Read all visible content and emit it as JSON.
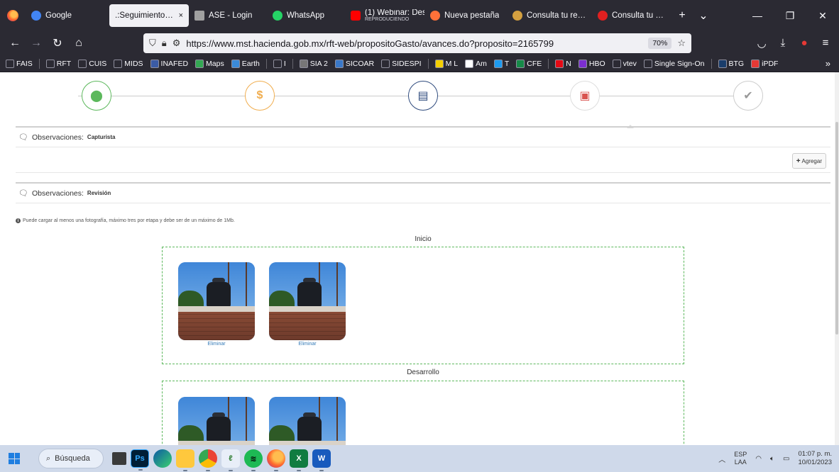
{
  "browser": {
    "tabs": [
      {
        "label": "Google",
        "color": "#4285f4",
        "active": false
      },
      {
        "label": ".:Seguimiento de l",
        "color": "#2e4a7d",
        "active": true
      },
      {
        "label": "ASE - Login",
        "color": "#a0a0a0",
        "active": false
      },
      {
        "label": "WhatsApp",
        "color": "#25d366",
        "active": false
      },
      {
        "label": "(1) Webinar: Des",
        "sub": "REPRODUCIENDO",
        "color": "#ff0000",
        "active": false
      },
      {
        "label": "Nueva pestaña",
        "color": "#ff7139",
        "active": false
      },
      {
        "label": "Consulta tu recib",
        "color": "#d4a040",
        "active": false
      },
      {
        "label": "Consulta tu recib",
        "color": "#e02020",
        "active": false
      }
    ],
    "tab_close": "×",
    "new_tab": "+",
    "tab_list": "⌄",
    "window_controls": {
      "minimize": "—",
      "maximize": "❐",
      "close": "✕"
    },
    "url": "https://www.mst.hacienda.gob.mx/rft-web/propositoGasto/avances.do?proposito=2165799",
    "zoom": "70%",
    "bookmarks": [
      {
        "label": "FAIS",
        "color": "#2b2a33"
      },
      {
        "label": "RFT",
        "color": "#2b2a33"
      },
      {
        "label": "CUIS",
        "color": "#2b2a33"
      },
      {
        "label": "MIDS",
        "color": "#2b2a33"
      },
      {
        "label": "INAFED",
        "color": "#3b5ba5"
      },
      {
        "label": "Maps",
        "color": "#34a853"
      },
      {
        "label": "Earth",
        "color": "#3b8ad8"
      },
      {
        "label": "I",
        "color": "#2b2a33"
      },
      {
        "label": "SIA 2",
        "color": "#777777"
      },
      {
        "label": "SICOAR",
        "color": "#3a78c8"
      },
      {
        "label": "SIDESPI",
        "color": "#2b2a33"
      },
      {
        "label": "M L",
        "color": "#f5d000"
      },
      {
        "label": "Am",
        "color": "#ffffff"
      },
      {
        "label": "T",
        "color": "#1d9bf0"
      },
      {
        "label": "CFE",
        "color": "#168a48"
      },
      {
        "label": "N",
        "color": "#e50914"
      },
      {
        "label": "HBO",
        "color": "#7b2fd0"
      },
      {
        "label": "vtev",
        "color": "#2b2a33"
      },
      {
        "label": "Single Sign-On",
        "color": "#2b2a33"
      },
      {
        "label": "BTG",
        "color": "#1a3d6b"
      },
      {
        "label": "iPDF",
        "color": "#e53935"
      }
    ]
  },
  "page": {
    "obs_capturista": {
      "label": "Observaciones:",
      "role": "Capturista"
    },
    "add_button": "Agregar",
    "obs_revision": {
      "label": "Observaciones:",
      "role": "Revisión"
    },
    "note": "Puede cargar al menos una fotografía, máximo tres por etapa y debe ser de un máximo de 1Mb.",
    "sections": [
      {
        "title": "Inicio",
        "photos": [
          {
            "action": "Eliminar"
          },
          {
            "action": "Eliminar"
          }
        ]
      },
      {
        "title": "Desarrollo",
        "photos": [
          {
            "action": ""
          },
          {
            "action": ""
          }
        ]
      }
    ]
  },
  "taskbar": {
    "search_placeholder": "Búsqueda",
    "apps": [
      "Ps",
      "Edge",
      "Explorer",
      "Chrome",
      "App",
      "Spotify",
      "Firefox",
      "X",
      "W"
    ],
    "lang": "ESP",
    "lang_sub": "LAA",
    "time": "01:07 p. m.",
    "date": "10/01/2023"
  }
}
